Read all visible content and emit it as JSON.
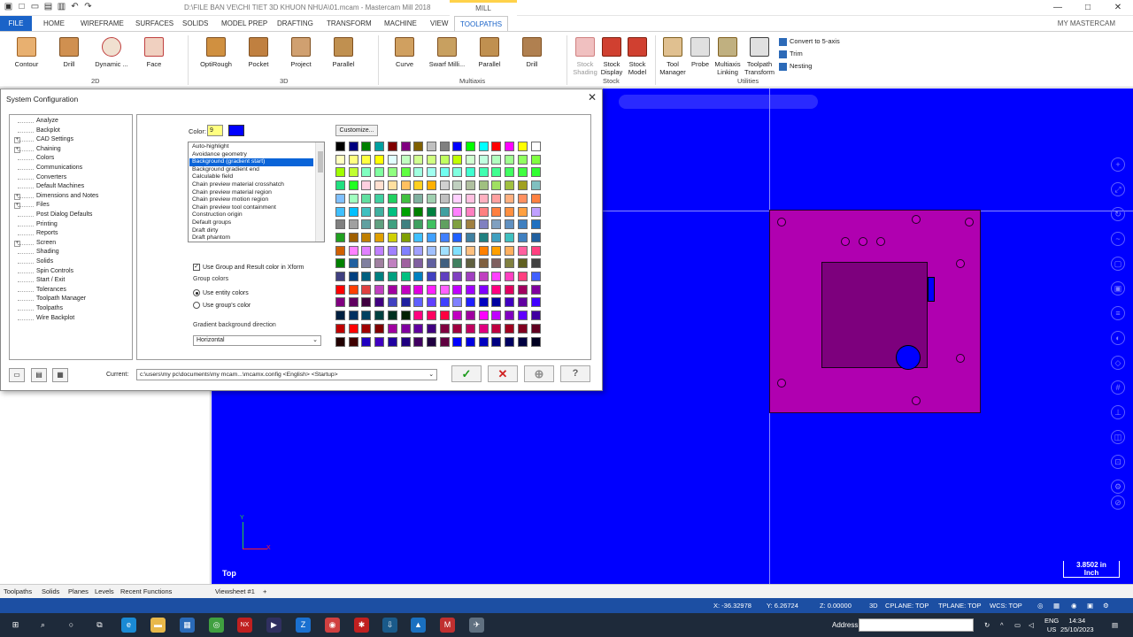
{
  "titlebar": {
    "path": "D:\\FILE BAN VE\\CHI TIET 3D KHUON NHUA\\01.mcam - Mastercam Mill 2018",
    "context_tab": "MILL"
  },
  "ribbon_tabs": [
    "FILE",
    "HOME",
    "WIREFRAME",
    "SURFACES",
    "SOLIDS",
    "MODEL PREP",
    "DRAFTING",
    "TRANSFORM",
    "MACHINE",
    "VIEW",
    "TOOLPATHS"
  ],
  "my_mastercam": "MY MASTERCAM",
  "ribbon": {
    "groups": {
      "g2d": "2D",
      "g3d": "3D",
      "multiaxis": "Multiaxis",
      "stock": "Stock",
      "utilities": "Utilities"
    },
    "buttons_2d": [
      "Contour",
      "Drill",
      "Dynamic ...",
      "Face"
    ],
    "buttons_3d": [
      "OptiRough",
      "Pocket",
      "Project",
      "Parallel"
    ],
    "buttons_multi": [
      "Curve",
      "Swarf Milli...",
      "Parallel",
      "Drill"
    ],
    "buttons_stock": [
      "Stock Shading",
      "Stock Display",
      "Stock Model"
    ],
    "buttons_util": [
      "Tool Manager",
      "Probe",
      "Multiaxis Linking",
      "Toolpath Transform"
    ],
    "mini": [
      "Convert to 5-axis",
      "Trim",
      "Nesting"
    ]
  },
  "dialog": {
    "title": "System Configuration",
    "tree": [
      "Analyze",
      "Backplot",
      "CAD Settings",
      "Chaining",
      "Colors",
      "Communications",
      "Converters",
      "Default Machines",
      "Dimensions and Notes",
      "Files",
      "Post Dialog Defaults",
      "Printing",
      "Reports",
      "Screen",
      "Shading",
      "Solids",
      "Spin Controls",
      "Start / Exit",
      "Tolerances",
      "Toolpath Manager",
      "Toolpaths",
      "Wire Backplot"
    ],
    "tree_expandable": [
      false,
      false,
      true,
      true,
      false,
      false,
      false,
      false,
      true,
      true,
      false,
      false,
      false,
      true,
      false,
      false,
      false,
      false,
      false,
      false,
      false,
      false
    ],
    "color_label": "Color:",
    "color_value": "9",
    "color_swatch": "#0000ff",
    "customize_label": "Customize...",
    "list_items": [
      "Auto-highlight",
      "Avoidance geometry",
      "Background (gradient start)",
      "Background gradient end",
      "Calculable field",
      "Chain preview material crosshatch",
      "Chain preview material region",
      "Chain preview motion region",
      "Chain preview tool containment",
      "Construction origin",
      "Default groups",
      "Draft dirty",
      "Draft phantom"
    ],
    "list_selected": "Background (gradient start)",
    "use_group_label": "Use Group and Result color in Xform",
    "use_group_checked": true,
    "group_colors_title": "Group colors",
    "radio_entity": "Use entity colors",
    "radio_group": "Use group's color",
    "radio_selected": "entity",
    "gradient_title": "Gradient background direction",
    "gradient_value": "Horizontal",
    "current_label": "Current:",
    "current_path": "c:\\users\\my pc\\documents\\my mcam...\\mcamx.config <English> <Startup>",
    "footer_icons": [
      "open-icon",
      "save-icon",
      "merge-icon"
    ],
    "actions": [
      "ok-checkmark-icon",
      "cancel-x-icon",
      "apply-plus-icon",
      "help-question-icon"
    ]
  },
  "palette": {
    "rows": [
      [
        "#000000",
        "#000080",
        "#008000",
        "#00a0a0",
        "#800000",
        "#800080",
        "#806000",
        "#c0c0c0",
        "#808080",
        "#0000ff",
        "#00ff00",
        "#00ffff",
        "#ff0000",
        "#ff00ff",
        "#ffff00",
        "#ffffff"
      ],
      [
        "#ffffc0",
        "#ffff80",
        "#ffff40",
        "#ffff00",
        "#e0ffff",
        "#c0ffc0",
        "#d0ff90",
        "#d0ff80",
        "#c0ff60",
        "#c0ff00",
        "#d0ffd0",
        "#c0ffe0",
        "#b0ffc0",
        "#a0ff90",
        "#90ff60",
        "#80ff40"
      ],
      [
        "#a0ff00",
        "#c0ff30",
        "#80ffc0",
        "#80ffa0",
        "#90ff80",
        "#60ff40",
        "#a0ffe0",
        "#a0fff0",
        "#70fff0",
        "#80ffe0",
        "#40ffd0",
        "#40ffb0",
        "#40ff90",
        "#40ff60",
        "#40ff40",
        "#30ff30"
      ],
      [
        "#20e080",
        "#20ff20",
        "#ffd0e0",
        "#ffe0d0",
        "#ffe0a0",
        "#ffc060",
        "#ffd020",
        "#ffb000",
        "#d0d0d0",
        "#c0d0c0",
        "#b0c0a0",
        "#a0c080",
        "#a0e060",
        "#a0c040",
        "#a0a020",
        "#80c0c0"
      ],
      [
        "#80c0ff",
        "#a0ffc0",
        "#60e0a0",
        "#40d0a0",
        "#20d060",
        "#40c040",
        "#80b0a0",
        "#a0d0b0",
        "#c0c0c0",
        "#ffd0ff",
        "#ffc0e0",
        "#ffb0c0",
        "#ffa0a0",
        "#ffb080",
        "#ff9060",
        "#ff8040"
      ],
      [
        "#40c0ff",
        "#00c0ff",
        "#40c0c0",
        "#40b0a0",
        "#00c080",
        "#00a000",
        "#008000",
        "#008040",
        "#40a0a0",
        "#ff80ff",
        "#ff80c0",
        "#ff8080",
        "#ff8040",
        "#ff9040",
        "#ffa040",
        "#c0a0ff"
      ],
      [
        "#808080",
        "#a0a0a0",
        "#60a0a0",
        "#60a080",
        "#40a080",
        "#408080",
        "#40a060",
        "#40c060",
        "#60a060",
        "#80a040",
        "#a08040",
        "#8080c0",
        "#80a0c0",
        "#6090c0",
        "#4080c0",
        "#2070c0"
      ],
      [
        "#20a020",
        "#a06000",
        "#c08000",
        "#e0a000",
        "#d0d000",
        "#80a000",
        "#40c0ff",
        "#40a0ff",
        "#4080ff",
        "#2060ff",
        "#4080a0",
        "#208080",
        "#40a0c0",
        "#40c0c0",
        "#4080c0",
        "#2060a0"
      ],
      [
        "#d06000",
        "#ff80ff",
        "#e080ff",
        "#c080ff",
        "#a080ff",
        "#8080ff",
        "#a0a0ff",
        "#a0c0ff",
        "#a0e0ff",
        "#80e0ff",
        "#ffc080",
        "#ff8000",
        "#ffa000",
        "#ffb060",
        "#ff60a0",
        "#ff4080"
      ],
      [
        "#008000",
        "#2060a0",
        "#8080a0",
        "#a080a0",
        "#c080c0",
        "#a060a0",
        "#8060a0",
        "#6060a0",
        "#406080",
        "#408060",
        "#606040",
        "#806040",
        "#806060",
        "#808040",
        "#606020",
        "#404040"
      ],
      [
        "#404080",
        "#004080",
        "#006080",
        "#008080",
        "#00a080",
        "#00c080",
        "#0080c0",
        "#4040c0",
        "#6040c0",
        "#8040c0",
        "#a040c0",
        "#c040c0",
        "#ff40ff",
        "#ff40c0",
        "#ff4080",
        "#4060ff"
      ],
      [
        "#ff0000",
        "#ff4000",
        "#e04040",
        "#c040c0",
        "#a000a0",
        "#c000c0",
        "#e000e0",
        "#ff20ff",
        "#ff60ff",
        "#c000ff",
        "#a000ff",
        "#8000ff",
        "#ff0080",
        "#e00060",
        "#a00060",
        "#8000a0"
      ],
      [
        "#800080",
        "#600060",
        "#400040",
        "#400080",
        "#4040c0",
        "#2020a0",
        "#6060ff",
        "#6040ff",
        "#4040ff",
        "#8080ff",
        "#2020ff",
        "#0000c0",
        "#0000a0",
        "#4000c0",
        "#6000a0",
        "#4000ff"
      ],
      [
        "#002040",
        "#003060",
        "#004060",
        "#004040",
        "#003020",
        "#002000",
        "#ff0080",
        "#ff0060",
        "#ff0040",
        "#c000c0",
        "#a000a0",
        "#ff00ff",
        "#c000ff",
        "#8000c0",
        "#6000ff",
        "#4000a0"
      ],
      [
        "#c00000",
        "#ff0000",
        "#a00000",
        "#800000",
        "#a000a0",
        "#8000a0",
        "#6000a0",
        "#400080",
        "#800040",
        "#a00040",
        "#c00060",
        "#e00080",
        "#c00040",
        "#a00020",
        "#800020",
        "#600020"
      ],
      [
        "#200000",
        "#400000",
        "#2000c0",
        "#4000c0",
        "#2000a0",
        "#200080",
        "#400060",
        "#200040",
        "#600040",
        "#0000ff",
        "#0000e0",
        "#0000c0",
        "#000080",
        "#000060",
        "#000040",
        "#000020"
      ]
    ]
  },
  "viewport": {
    "background": "#0000ff",
    "view_name": "Top",
    "scale_value": "3.8502 in",
    "scale_unit": "Inch",
    "axis_y": "Y",
    "axis_x": "X"
  },
  "bottom_tabs": [
    "Toolpaths",
    "Solids",
    "Planes",
    "Levels",
    "Recent Functions"
  ],
  "viewsheet": "Viewsheet #1",
  "status": {
    "x": "X:   -36.32978",
    "y": "Y:   6.26724",
    "z": "Z:   0.00000",
    "mode": "3D",
    "cplane": "CPLANE: TOP",
    "tplane": "TPLANE: TOP",
    "wcs": "WCS: TOP"
  },
  "taskbar": {
    "address_label": "Address",
    "lang": "ENG",
    "region": "US",
    "time": "14:34",
    "date": "25/10/2023"
  }
}
